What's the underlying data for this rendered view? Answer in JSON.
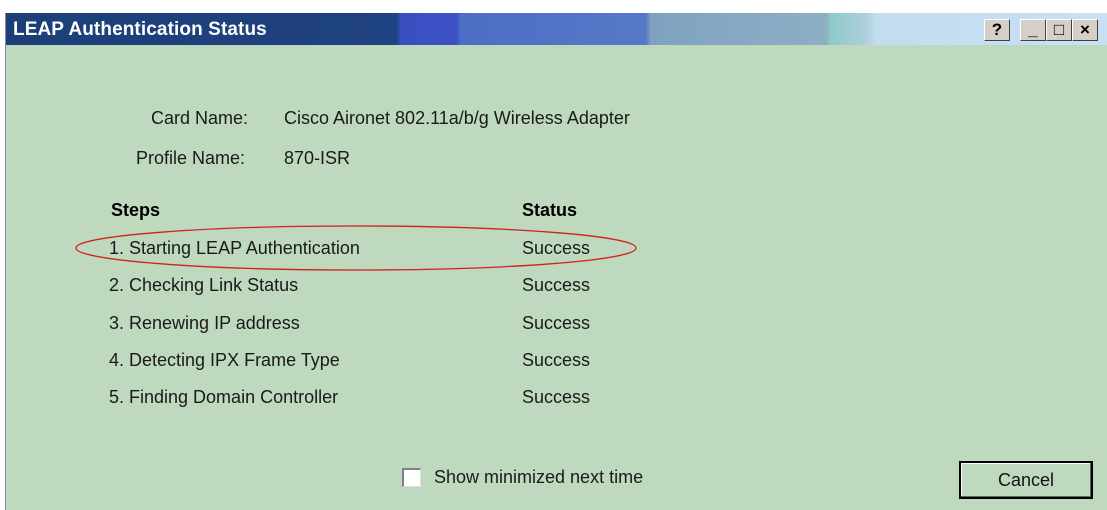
{
  "window": {
    "title": "LEAP Authentication Status",
    "title_buttons": {
      "help": "?",
      "minimize": "_",
      "maximize": "□",
      "close": "×"
    }
  },
  "card_name": {
    "label": "Card Name:",
    "value": "Cisco Aironet 802.11a/b/g Wireless Adapter"
  },
  "profile_name": {
    "label": "Profile Name:",
    "value": "870-ISR"
  },
  "steps_table": {
    "headers": [
      "Steps",
      "Status"
    ],
    "rows": [
      {
        "step": "1. Starting LEAP Authentication",
        "status": "Success"
      },
      {
        "step": "2. Checking Link Status",
        "status": "Success"
      },
      {
        "step": "3. Renewing IP address",
        "status": "Success"
      },
      {
        "step": "4. Detecting IPX Frame Type",
        "status": "Success"
      },
      {
        "step": "5. Finding Domain Controller",
        "status": "Success"
      }
    ]
  },
  "show_minimized": {
    "label": "Show minimized next time",
    "checked": false
  },
  "cancel_label": "Cancel",
  "colors": {
    "dialog_background": "#bfd9bf",
    "titlebar_start": "#1c3f78",
    "annotation_ellipse": "#d02020"
  }
}
